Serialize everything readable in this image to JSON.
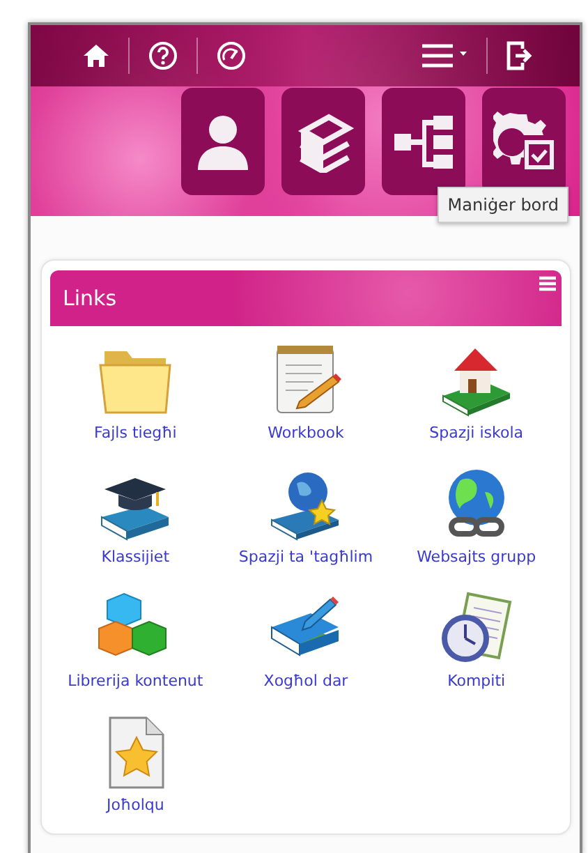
{
  "topbar": {
    "left": [
      {
        "kind": "home"
      },
      {
        "kind": "help"
      },
      {
        "kind": "dashboard"
      }
    ],
    "right": [
      {
        "kind": "menu"
      },
      {
        "kind": "logout"
      }
    ]
  },
  "tiles": [
    {
      "kind": "profile"
    },
    {
      "kind": "books"
    },
    {
      "kind": "hierarchy"
    },
    {
      "kind": "manager"
    }
  ],
  "tooltip": "Maniġer bord",
  "card": {
    "title": "Links",
    "links": [
      {
        "label": "Fajls tiegħi",
        "kind": "folder"
      },
      {
        "label": "Workbook",
        "kind": "notepad"
      },
      {
        "label": "Spazji iskola",
        "kind": "school"
      },
      {
        "label": "Klassijiet",
        "kind": "graduation"
      },
      {
        "label": "Spazji ta 'tagħlim",
        "kind": "globe-book"
      },
      {
        "label": "Websajts grupp",
        "kind": "globe-link"
      },
      {
        "label": "Librerija kontenut",
        "kind": "cubes"
      },
      {
        "label": "Xogħol dar",
        "kind": "book-pencil"
      },
      {
        "label": "Kompiti",
        "kind": "clock-doc"
      },
      {
        "label": "Joħolqu",
        "kind": "star-doc"
      }
    ]
  }
}
